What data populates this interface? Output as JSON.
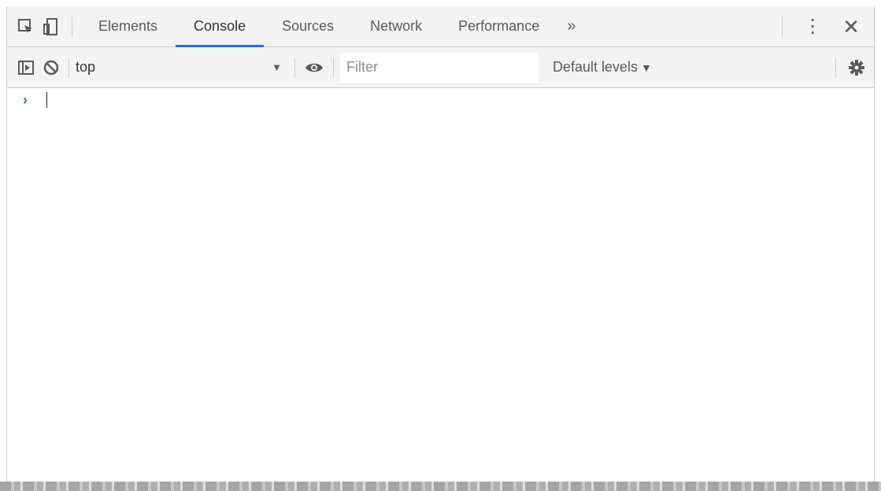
{
  "tabbar": {
    "inspect_icon": "element-picker-icon",
    "device_icon": "device-toolbar-icon",
    "tabs": [
      {
        "label": "Elements",
        "active": false
      },
      {
        "label": "Console",
        "active": true
      },
      {
        "label": "Sources",
        "active": false
      },
      {
        "label": "Network",
        "active": false
      },
      {
        "label": "Performance",
        "active": false
      }
    ],
    "more_tabs_label": "»",
    "menu_label": "⋮",
    "close_label": "✕"
  },
  "toolbar": {
    "sidebar_icon": "sidebar-toggle-icon",
    "clear_icon": "clear-console-icon",
    "context_value": "top",
    "context_arrow": "▼",
    "eye_icon": "live-expression-icon",
    "filter_placeholder": "Filter",
    "filter_value": "",
    "levels_label": "Default levels",
    "levels_arrow": "▼",
    "settings_icon": "gear-icon"
  },
  "console": {
    "prompt_symbol": "›",
    "input_value": ""
  },
  "colors": {
    "accent": "#1a73e8",
    "toolbar_bg": "#f3f3f3",
    "border": "#cccccc"
  }
}
